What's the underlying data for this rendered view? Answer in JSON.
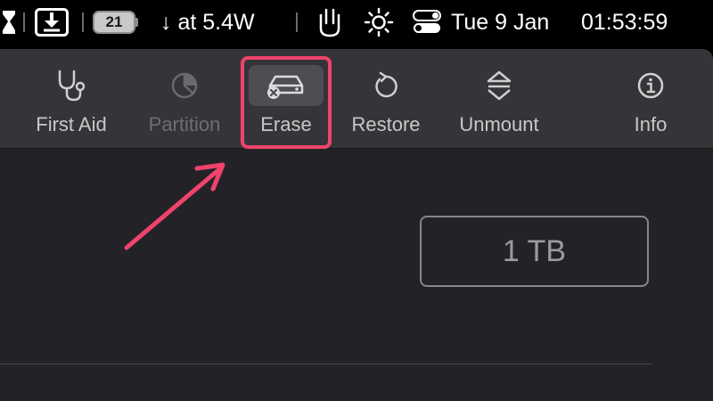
{
  "menubar": {
    "battery_percent": "21",
    "power_status": "↓ at 5.4W",
    "date": "Tue 9 Jan",
    "time": "01:53:59",
    "icons": [
      "hourglass-icon",
      "download-icon",
      "battery-icon",
      "hand-icon",
      "brightness-icon",
      "control-center-icon"
    ]
  },
  "toolbar": {
    "items": [
      {
        "label": "First Aid",
        "icon": "stethoscope-icon",
        "enabled": true
      },
      {
        "label": "Partition",
        "icon": "pie-chart-icon",
        "enabled": false
      },
      {
        "label": "Erase",
        "icon": "erase-disk-icon",
        "enabled": true,
        "selected": true
      },
      {
        "label": "Restore",
        "icon": "restore-icon",
        "enabled": true
      },
      {
        "label": "Unmount",
        "icon": "unmount-icon",
        "enabled": true
      },
      {
        "label": "Info",
        "icon": "info-icon",
        "enabled": true
      }
    ]
  },
  "main": {
    "capacity_label": "1 TB"
  },
  "colors": {
    "highlight": "#f0436b",
    "toolbar_bg": "#353539",
    "window_bg": "#232327"
  }
}
